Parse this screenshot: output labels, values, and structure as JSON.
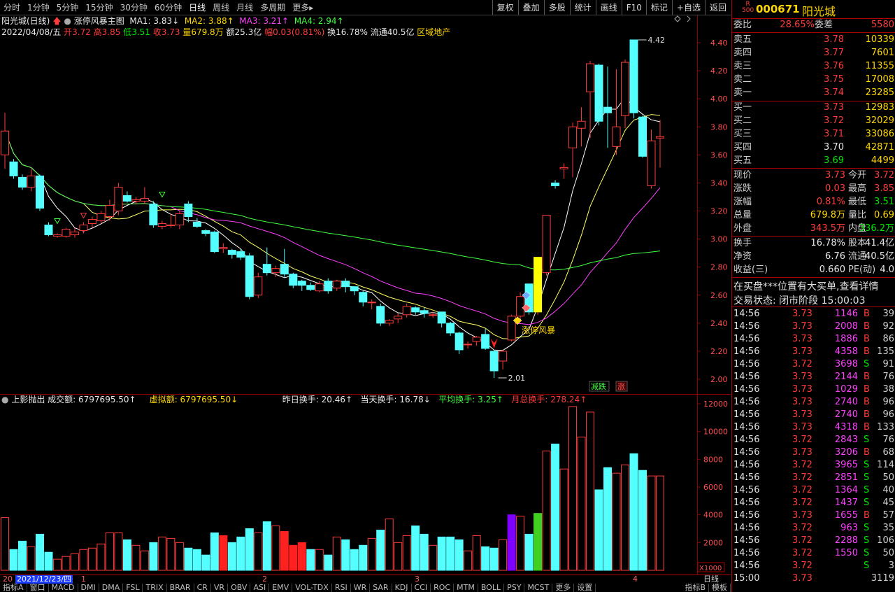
{
  "toolbar": {
    "periods": [
      "分时",
      "1分钟",
      "5分钟",
      "15分钟",
      "30分钟",
      "60分钟",
      "日线",
      "周线",
      "月线",
      "多周期",
      "更多▸"
    ],
    "active_period": "日线",
    "tools": [
      "复权",
      "叠加",
      "多股",
      "统计",
      "画线",
      "F10",
      "标记",
      "+自选",
      "返回"
    ]
  },
  "main_header": {
    "stock_title": "阳光城(日线)",
    "indicator_name": "涨停风暴主图",
    "ma1": "MA1: 3.83↓",
    "ma2": "MA2: 3.88↑",
    "ma3": "MA3: 3.21↑",
    "ma4": "MA4: 2.94↑"
  },
  "quote_line": {
    "date": "2022/04/08/五",
    "open_label": "开",
    "open": "3.72",
    "high_label": "高",
    "high": "3.85",
    "low_label": "低",
    "low": "3.51",
    "close_label": "收",
    "close": "3.73",
    "vol_label": "量",
    "vol": "679.8万",
    "amt_label": "额",
    "amt": "25.3亿",
    "chg_label": "幅",
    "chg": "0.03(0.81%)",
    "turnover": "换16.78%",
    "float": "流通40.5亿",
    "sector": "区域地产"
  },
  "price_axis": [
    "4.40",
    "4.20",
    "4.00",
    "3.80",
    "3.60",
    "3.40",
    "3.20",
    "3.00",
    "2.80",
    "2.60",
    "2.40",
    "2.20",
    "2.00"
  ],
  "annotations": {
    "high_mark": "4.42",
    "low_mark": "2.01",
    "signal_label": "涨停风暴",
    "badge_down": "减跌",
    "badge_up": "涨"
  },
  "vol_header": {
    "indicator": "上影抛出",
    "volume": "成交额: 6797695.50↑",
    "virtual": "虚拟额: 6797695.50↓",
    "yday_turn": "昨日换手: 20.46↑",
    "today_turn": "当天换手: 16.78↓",
    "avg_turn": "平均换手: 3.25↑",
    "month_turn": "月总换手: 278.24↑"
  },
  "vol_axis": [
    "12000",
    "10000",
    "8000",
    "6000",
    "4000",
    "2000"
  ],
  "vol_unit": "X1000",
  "date_axis": {
    "cursor_date": "2021/12/23/四",
    "prefix": "20",
    "month_marks": [
      "1",
      "2",
      "3",
      "4"
    ],
    "right_label": "日线"
  },
  "bottom_tabs": [
    "指标A",
    "窗口",
    "MACD",
    "DMI",
    "DMA",
    "FSL",
    "TRIX",
    "BRAR",
    "CR",
    "VR",
    "OBV",
    "ASI",
    "EMV",
    "VOL-TDX",
    "RSI",
    "WR",
    "SAR",
    "KDJ",
    "CCI",
    "ROC",
    "MTM",
    "BOLL",
    "PSY",
    "MCST",
    "更多",
    "设置"
  ],
  "bottom_right_tabs": [
    "指标B",
    "模板"
  ],
  "chart_data": {
    "type": "candlestick",
    "ylim": [
      2.0,
      4.5
    ],
    "candles": [
      [
        3.6,
        3.77,
        3.5,
        3.9
      ],
      [
        3.55,
        3.45,
        3.43,
        3.57
      ],
      [
        3.44,
        3.37,
        3.35,
        3.46
      ],
      [
        3.37,
        3.45,
        3.34,
        3.5
      ],
      [
        3.45,
        3.22,
        3.2,
        3.46
      ],
      [
        3.1,
        3.03,
        3.02,
        3.12
      ],
      [
        3.02,
        3.03,
        3.01,
        3.04
      ],
      [
        3.02,
        3.07,
        3.01,
        3.08
      ],
      [
        3.03,
        3.05,
        3.01,
        3.08
      ],
      [
        3.06,
        3.1,
        3.04,
        3.12
      ],
      [
        3.11,
        3.14,
        3.08,
        3.16
      ],
      [
        3.13,
        3.18,
        3.11,
        3.2
      ],
      [
        3.16,
        3.24,
        3.13,
        3.28
      ],
      [
        3.2,
        3.37,
        3.17,
        3.4
      ],
      [
        3.31,
        3.27,
        3.26,
        3.34
      ],
      [
        3.27,
        3.28,
        3.25,
        3.3
      ],
      [
        3.27,
        3.29,
        3.25,
        3.37
      ],
      [
        3.25,
        3.1,
        3.08,
        3.27
      ],
      [
        3.09,
        3.11,
        3.07,
        3.13
      ],
      [
        3.1,
        3.1,
        3.08,
        3.18
      ],
      [
        3.1,
        3.18,
        3.07,
        3.2
      ],
      [
        3.25,
        3.16,
        3.12,
        3.27
      ],
      [
        3.12,
        3.09,
        3.08,
        3.15
      ],
      [
        3.06,
        3.04,
        3.02,
        3.07
      ],
      [
        3.05,
        2.91,
        2.9,
        3.06
      ],
      [
        2.93,
        2.94,
        2.9,
        2.97
      ],
      [
        2.92,
        2.89,
        2.86,
        2.93
      ],
      [
        2.91,
        2.87,
        2.85,
        2.93
      ],
      [
        2.88,
        2.59,
        2.57,
        2.9
      ],
      [
        2.6,
        2.73,
        2.58,
        2.76
      ],
      [
        2.82,
        2.76,
        2.74,
        2.94
      ],
      [
        2.76,
        2.79,
        2.73,
        2.81
      ],
      [
        2.82,
        2.75,
        2.73,
        2.93
      ],
      [
        2.75,
        2.67,
        2.65,
        2.76
      ],
      [
        2.7,
        2.67,
        2.63,
        2.71
      ],
      [
        2.67,
        2.64,
        2.63,
        2.69
      ],
      [
        2.63,
        2.68,
        2.62,
        2.7
      ],
      [
        2.7,
        2.63,
        2.61,
        2.72
      ],
      [
        2.65,
        2.7,
        2.63,
        2.71
      ],
      [
        2.7,
        2.66,
        2.62,
        2.72
      ],
      [
        2.66,
        2.63,
        2.6,
        2.66
      ],
      [
        2.62,
        2.55,
        2.52,
        2.63
      ],
      [
        2.55,
        2.55,
        2.5,
        2.57
      ],
      [
        2.52,
        2.4,
        2.38,
        2.54
      ],
      [
        2.4,
        2.42,
        2.38,
        2.43
      ],
      [
        2.43,
        2.45,
        2.4,
        2.47
      ],
      [
        2.46,
        2.52,
        2.44,
        2.54
      ],
      [
        2.51,
        2.48,
        2.46,
        2.52
      ],
      [
        2.49,
        2.47,
        2.44,
        2.51
      ],
      [
        2.46,
        2.46,
        2.44,
        2.48
      ],
      [
        2.48,
        2.4,
        2.37,
        2.48
      ],
      [
        2.4,
        2.33,
        2.31,
        2.41
      ],
      [
        2.33,
        2.21,
        2.18,
        2.34
      ],
      [
        2.25,
        2.25,
        2.22,
        2.27
      ],
      [
        2.27,
        2.3,
        2.24,
        2.31
      ],
      [
        2.32,
        2.22,
        2.21,
        2.36
      ],
      [
        2.2,
        2.06,
        2.01,
        2.21
      ],
      [
        2.13,
        2.2,
        2.07,
        2.21
      ],
      [
        2.28,
        2.45,
        2.27,
        2.46
      ],
      [
        2.45,
        2.59,
        2.42,
        2.62
      ],
      [
        2.68,
        2.48,
        2.46,
        2.68
      ],
      [
        2.48,
        2.87,
        2.46,
        2.87
      ],
      [
        2.76,
        3.17,
        2.74,
        3.17
      ],
      [
        3.4,
        3.38,
        3.36,
        3.42
      ],
      [
        3.5,
        3.51,
        3.43,
        3.54
      ],
      [
        3.65,
        3.8,
        3.44,
        3.83
      ],
      [
        3.79,
        3.84,
        3.66,
        3.94
      ],
      [
        4.05,
        4.25,
        3.72,
        4.27
      ],
      [
        4.24,
        3.84,
        3.81,
        4.25
      ],
      [
        3.94,
        3.9,
        3.65,
        4.23
      ],
      [
        3.66,
        3.8,
        3.6,
        4.21
      ],
      [
        3.88,
        4.26,
        3.79,
        4.28
      ],
      [
        4.42,
        3.9,
        3.86,
        4.42
      ],
      [
        3.87,
        3.59,
        3.58,
        3.88
      ],
      [
        3.38,
        3.7,
        3.36,
        3.78
      ],
      [
        3.72,
        3.73,
        3.51,
        3.85
      ]
    ],
    "volume": [
      3.8,
      1.5,
      2.1,
      1.7,
      2.6,
      1.3,
      0.8,
      1.0,
      1.2,
      1.5,
      1.6,
      1.9,
      2.7,
      2.7,
      2.2,
      1.8,
      1.4,
      2.0,
      2.4,
      2.3,
      2.0,
      1.6,
      1.5,
      1.1,
      2.7,
      2.5,
      2.0,
      2.4,
      3.0,
      2.7,
      3.5,
      3.2,
      2.8,
      1.8,
      2.0,
      1.5,
      1.5,
      1.1,
      2.4,
      2.2,
      1.5,
      1.8,
      2.3,
      2.9,
      3.7,
      2.0,
      2.5,
      3.2,
      2.6,
      1.8,
      2.4,
      2.4,
      2.2,
      1.4,
      2.5,
      1.7,
      1.6,
      2.2,
      4.0,
      3.9,
      2.6,
      4.1,
      8.6,
      9.1,
      7.3,
      11.8,
      9.6,
      11.4,
      5.8,
      7.4,
      7.0,
      7.6,
      8.4,
      7.2,
      6.8,
      6.8
    ]
  },
  "right_panel": {
    "code": "000671",
    "name": "阳光城",
    "r_badge": "R",
    "r_sub": "500",
    "weibi_label": "委比",
    "weibi": "28.65%",
    "weicha_label": "委差",
    "weicha": "5580",
    "asks": [
      {
        "label": "卖五",
        "price": "3.78",
        "vol": "10339"
      },
      {
        "label": "卖四",
        "price": "3.77",
        "vol": "7601"
      },
      {
        "label": "卖三",
        "price": "3.76",
        "vol": "11355"
      },
      {
        "label": "卖二",
        "price": "3.75",
        "vol": "17008"
      },
      {
        "label": "卖一",
        "price": "3.74",
        "vol": "23285"
      }
    ],
    "bids": [
      {
        "label": "买一",
        "price": "3.73",
        "vol": "12983"
      },
      {
        "label": "买二",
        "price": "3.72",
        "vol": "32029"
      },
      {
        "label": "买三",
        "price": "3.71",
        "vol": "33086"
      },
      {
        "label": "买四",
        "price": "3.70",
        "vol": "42871"
      },
      {
        "label": "买五",
        "price": "3.69",
        "vol": "4499"
      }
    ],
    "stats": [
      {
        "l1": "现价",
        "v1": "3.73",
        "l2": "今开",
        "v2": "3.72"
      },
      {
        "l1": "涨跌",
        "v1": "0.03",
        "l2": "最高",
        "v2": "3.85"
      },
      {
        "l1": "涨幅",
        "v1": "0.81%",
        "l2": "最低",
        "v2": "3.51"
      },
      {
        "l1": "总量",
        "v1": "679.8万",
        "l2": "量比",
        "v2": "0.69"
      },
      {
        "l1": "外盘",
        "v1": "343.5万",
        "l2": "内盘",
        "v2": "336.2万"
      }
    ],
    "stats2": [
      {
        "l1": "换手",
        "v1": "16.78%",
        "l2": "股本",
        "v2": "41.4亿"
      },
      {
        "l1": "净资",
        "v1": "6.76",
        "l2": "流通",
        "v2": "40.5亿"
      },
      {
        "l1": "收益(三)",
        "v1": "0.660",
        "l2": "PE(动)",
        "v2": "4.0"
      }
    ],
    "notice": "在买盘***位置有大买单,查看详情",
    "trade_status": "交易状态: 闭市阶段 15:00:03",
    "ticks": [
      {
        "t": "14:56",
        "p": "3.73",
        "v": "1146",
        "bs": "B",
        "n": "39"
      },
      {
        "t": "14:56",
        "p": "3.73",
        "v": "2008",
        "bs": "B",
        "n": "92"
      },
      {
        "t": "14:56",
        "p": "3.73",
        "v": "1886",
        "bs": "B",
        "n": "86"
      },
      {
        "t": "14:56",
        "p": "3.73",
        "v": "4358",
        "bs": "B",
        "n": "135"
      },
      {
        "t": "14:56",
        "p": "3.72",
        "v": "3698",
        "bs": "S",
        "n": "91"
      },
      {
        "t": "14:56",
        "p": "3.73",
        "v": "2144",
        "bs": "B",
        "n": "76"
      },
      {
        "t": "14:56",
        "p": "3.73",
        "v": "1029",
        "bs": "B",
        "n": "38"
      },
      {
        "t": "14:56",
        "p": "3.73",
        "v": "2740",
        "bs": "B",
        "n": "96"
      },
      {
        "t": "14:56",
        "p": "3.73",
        "v": "2740",
        "bs": "B",
        "n": "96"
      },
      {
        "t": "14:56",
        "p": "3.73",
        "v": "4318",
        "bs": "B",
        "n": "133"
      },
      {
        "t": "14:56",
        "p": "3.72",
        "v": "2843",
        "bs": "S",
        "n": "76"
      },
      {
        "t": "14:56",
        "p": "3.73",
        "v": "3206",
        "bs": "B",
        "n": "68"
      },
      {
        "t": "14:56",
        "p": "3.72",
        "v": "3965",
        "bs": "S",
        "n": "114"
      },
      {
        "t": "14:56",
        "p": "3.72",
        "v": "2851",
        "bs": "S",
        "n": "50"
      },
      {
        "t": "14:56",
        "p": "3.72",
        "v": "1364",
        "bs": "S",
        "n": "40"
      },
      {
        "t": "14:56",
        "p": "3.72",
        "v": "1437",
        "bs": "S",
        "n": "45"
      },
      {
        "t": "14:56",
        "p": "3.73",
        "v": "1655",
        "bs": "B",
        "n": "57"
      },
      {
        "t": "14:56",
        "p": "3.72",
        "v": "963",
        "bs": "S",
        "n": "35"
      },
      {
        "t": "14:56",
        "p": "3.72",
        "v": "2288",
        "bs": "S",
        "n": "106"
      },
      {
        "t": "14:56",
        "p": "3.72",
        "v": "1550",
        "bs": "S",
        "n": "50"
      },
      {
        "t": "14:56",
        "p": "3.72",
        "v": "",
        "bs": "S",
        "n": "3"
      },
      {
        "t": "15:00",
        "p": "3.73",
        "v": "",
        "bs": "",
        "n": "3119"
      }
    ]
  },
  "colors": {
    "up": "#ff3b3b",
    "down": "#54ffff",
    "ma1": "#ffffff",
    "ma2": "#ffff60",
    "ma3": "#ff40ff",
    "ma4": "#40ff40",
    "grid": "#8b0000"
  }
}
